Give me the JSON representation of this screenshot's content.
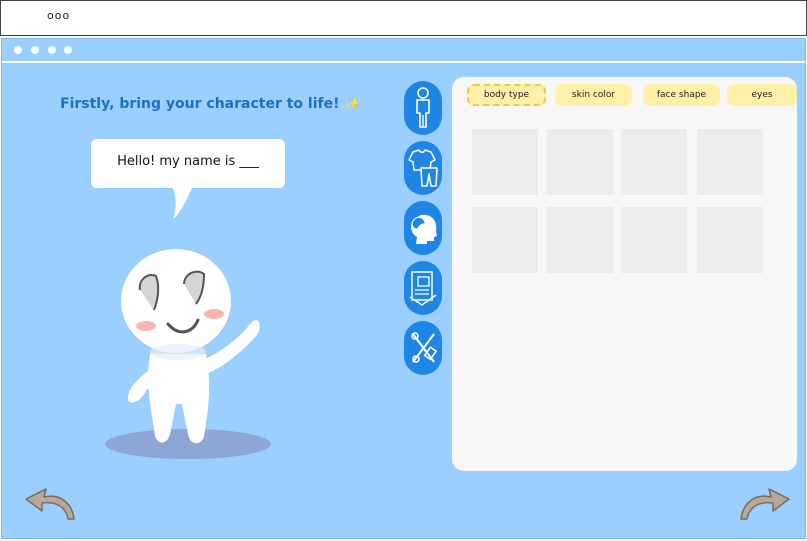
{
  "app": {
    "title": "ooo"
  },
  "headline": {
    "text": "Firstly, bring your character to life!",
    "sparkle": "✨"
  },
  "speech_bubble": {
    "text": "Hello! my name is ___"
  },
  "categories": [
    {
      "id": "body",
      "icon": "body-icon"
    },
    {
      "id": "clothes",
      "icon": "clothing-icon"
    },
    {
      "id": "head",
      "icon": "head-icon"
    },
    {
      "id": "documents",
      "icon": "document-icon"
    },
    {
      "id": "tools",
      "icon": "tools-icon"
    }
  ],
  "tabs": [
    {
      "label": "body type",
      "active": true
    },
    {
      "label": "skin color",
      "active": false
    },
    {
      "label": "face shape",
      "active": false
    },
    {
      "label": "eyes",
      "active": false
    }
  ],
  "colors": {
    "background": "#9bcfff",
    "accent": "#1f86e6",
    "headline": "#1e6fc4",
    "tab": "#fff0a8",
    "tab_active_border": "#f0c84a",
    "tile": "#ececec",
    "panel": "#f8f8f8"
  },
  "navigation": {
    "back_icon": "undo-arrow-icon",
    "next_icon": "redo-arrow-icon"
  }
}
